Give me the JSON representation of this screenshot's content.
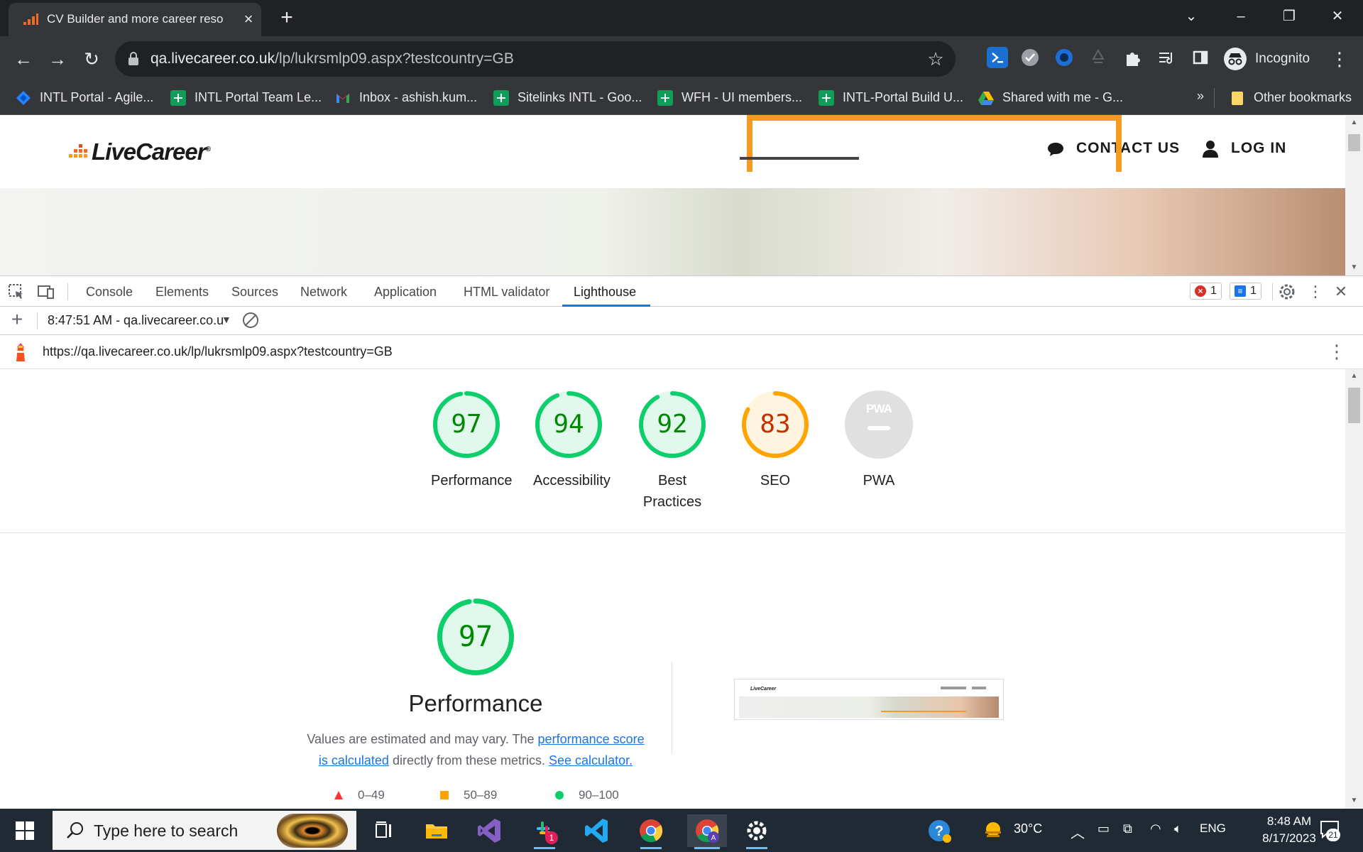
{
  "browser": {
    "tab_title": "CV Builder and more career reso",
    "address_host": "qa.livecareer.co.uk",
    "address_path": "/lp/lukrsmlp09.aspx?testcountry=GB",
    "profile_label": "Incognito",
    "bookmarks": [
      {
        "label": "INTL Portal - Agile...",
        "icon": "jira-icon"
      },
      {
        "label": "INTL Portal Team Le...",
        "icon": "google-sheets-icon"
      },
      {
        "label": "Inbox - ashish.kum...",
        "icon": "gmail-icon"
      },
      {
        "label": "Sitelinks INTL - Goo...",
        "icon": "google-sheets-icon"
      },
      {
        "label": "WFH - UI members...",
        "icon": "google-sheets-icon"
      },
      {
        "label": "INTL-Portal Build U...",
        "icon": "google-sheets-icon"
      },
      {
        "label": "Shared with me - G...",
        "icon": "google-drive-icon"
      }
    ],
    "bookmarks_overflow": "»",
    "other_bookmarks": "Other bookmarks"
  },
  "site": {
    "logo_text": "LiveCareer",
    "logo_mark": "®",
    "contact_label": "CONTACT US",
    "login_label": "LOG IN",
    "accent_color": "#f79a20"
  },
  "devtools": {
    "tabs": [
      "Console",
      "Elements",
      "Sources",
      "Network",
      "Application",
      "HTML validator",
      "Lighthouse"
    ],
    "active_tab": "Lighthouse",
    "error_count": "1",
    "message_count": "1",
    "report_selector": "8:47:51 AM - qa.livecareer.co.u",
    "report_url": "https://qa.livecareer.co.uk/lp/lukrsmlp09.aspx?testcountry=GB"
  },
  "lighthouse": {
    "scores": [
      {
        "label": "Performance",
        "value": 97,
        "color": "#0cce6b",
        "text_color": "#008800"
      },
      {
        "label": "Accessibility",
        "value": 94,
        "color": "#0cce6b",
        "text_color": "#008800"
      },
      {
        "label": "Best Practices",
        "value": 92,
        "color": "#0cce6b",
        "text_color": "#008800"
      },
      {
        "label": "SEO",
        "value": 83,
        "color": "#ffa400",
        "text_color": "#c33300"
      }
    ],
    "pwa": {
      "label": "PWA",
      "badge_text": "PWA"
    },
    "performance": {
      "score": 97,
      "title": "Performance",
      "desc_pre": "Values are estimated and may vary. The ",
      "desc_link1": "performance score is calculated",
      "desc_mid": " directly from these metrics. ",
      "desc_link2": "See calculator."
    },
    "legend": [
      {
        "range": "0–49",
        "shape": "triangle",
        "color": "#ff3333"
      },
      {
        "range": "50–89",
        "shape": "square",
        "color": "#ffa400"
      },
      {
        "range": "90–100",
        "shape": "circle",
        "color": "#0cce6b"
      }
    ]
  },
  "taskbar": {
    "search_placeholder": "Type here to search",
    "weather": "30°C",
    "language": "ENG",
    "time": "8:48 AM",
    "date": "8/17/2023",
    "notification_count": "21",
    "slack_badge": "1"
  }
}
